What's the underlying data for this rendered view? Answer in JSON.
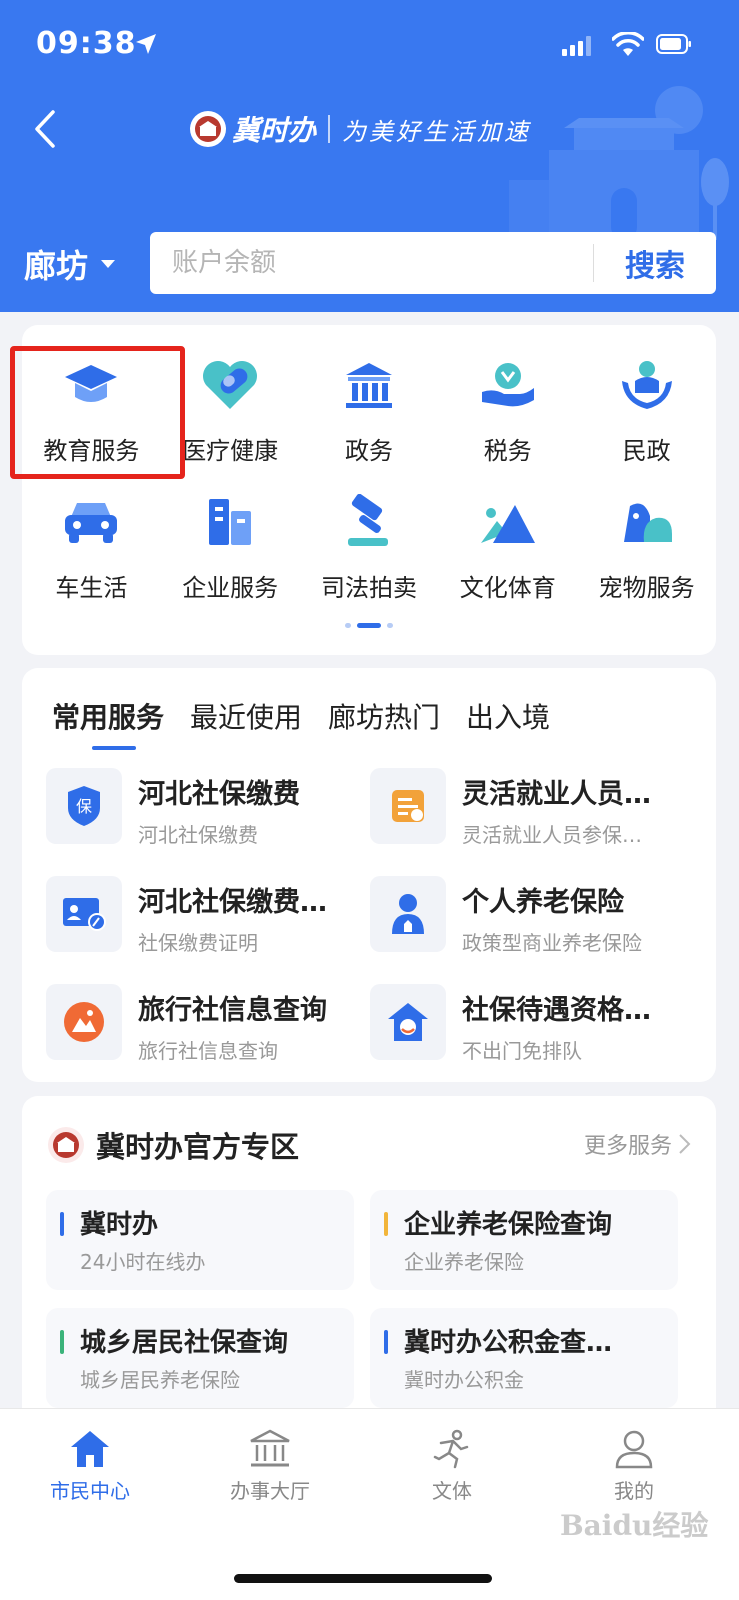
{
  "status_bar": {
    "time": "09:38"
  },
  "header": {
    "brand_name": "冀时办",
    "slogan": "为美好生活加速",
    "city": "廊坊",
    "search_placeholder": "账户余额",
    "search_button": "搜索"
  },
  "grid": {
    "row1": [
      {
        "label": "教育服务",
        "icon": "graduation-cap-icon"
      },
      {
        "label": "医疗健康",
        "icon": "medical-heart-icon"
      },
      {
        "label": "政务",
        "icon": "government-building-icon"
      },
      {
        "label": "税务",
        "icon": "tax-hand-icon"
      },
      {
        "label": "民政",
        "icon": "civil-affairs-icon"
      }
    ],
    "row2": [
      {
        "label": "车生活",
        "icon": "car-icon"
      },
      {
        "label": "企业服务",
        "icon": "enterprise-building-icon"
      },
      {
        "label": "司法拍卖",
        "icon": "gavel-icon"
      },
      {
        "label": "文化体育",
        "icon": "mountain-icon"
      },
      {
        "label": "宠物服务",
        "icon": "pet-icon"
      }
    ],
    "highlighted": "教育服务"
  },
  "services": {
    "tabs": [
      "常用服务",
      "最近使用",
      "廊坊热门",
      "出入境"
    ],
    "active_tab": "常用服务",
    "items": [
      {
        "title": "河北社保缴费",
        "subtitle": "河北社保缴费",
        "icon": "social-insurance-shield-icon"
      },
      {
        "title": "灵活就业人员…",
        "subtitle": "灵活就业人员参保…",
        "icon": "employment-card-icon"
      },
      {
        "title": "河北社保缴费…",
        "subtitle": "社保缴费证明",
        "icon": "certificate-edit-icon"
      },
      {
        "title": "个人养老保险",
        "subtitle": "政策型商业养老保险",
        "icon": "person-icon"
      },
      {
        "title": "旅行社信息查询",
        "subtitle": "旅行社信息查询",
        "icon": "travel-agency-icon"
      },
      {
        "title": "社保待遇资格…",
        "subtitle": "不出门免排队",
        "icon": "home-elder-icon"
      }
    ]
  },
  "zone": {
    "title": "冀时办官方专区",
    "more": "更多服务",
    "items": [
      {
        "title": "冀时办",
        "subtitle": "24小时在线办",
        "color": "#2f6de8"
      },
      {
        "title": "企业养老保险查询",
        "subtitle": "企业养老保险",
        "color": "#f2b53a"
      },
      {
        "title": "城乡居民社保查询",
        "subtitle": "城乡居民养老保险",
        "color": "#3bb37a"
      },
      {
        "title": "冀时办公积金查…",
        "subtitle": "冀时办公积金",
        "color": "#2f6de8"
      }
    ]
  },
  "bottom_nav": [
    {
      "label": "市民中心",
      "icon": "home-icon",
      "active": true
    },
    {
      "label": "办事大厅",
      "icon": "hall-icon",
      "active": false
    },
    {
      "label": "文体",
      "icon": "running-icon",
      "active": false
    },
    {
      "label": "我的",
      "icon": "profile-icon",
      "active": false
    }
  ],
  "watermark": "Baidu经验",
  "colors": {
    "primary": "#3978f0",
    "accent": "#2f6de8",
    "highlight": "#e5241c"
  }
}
